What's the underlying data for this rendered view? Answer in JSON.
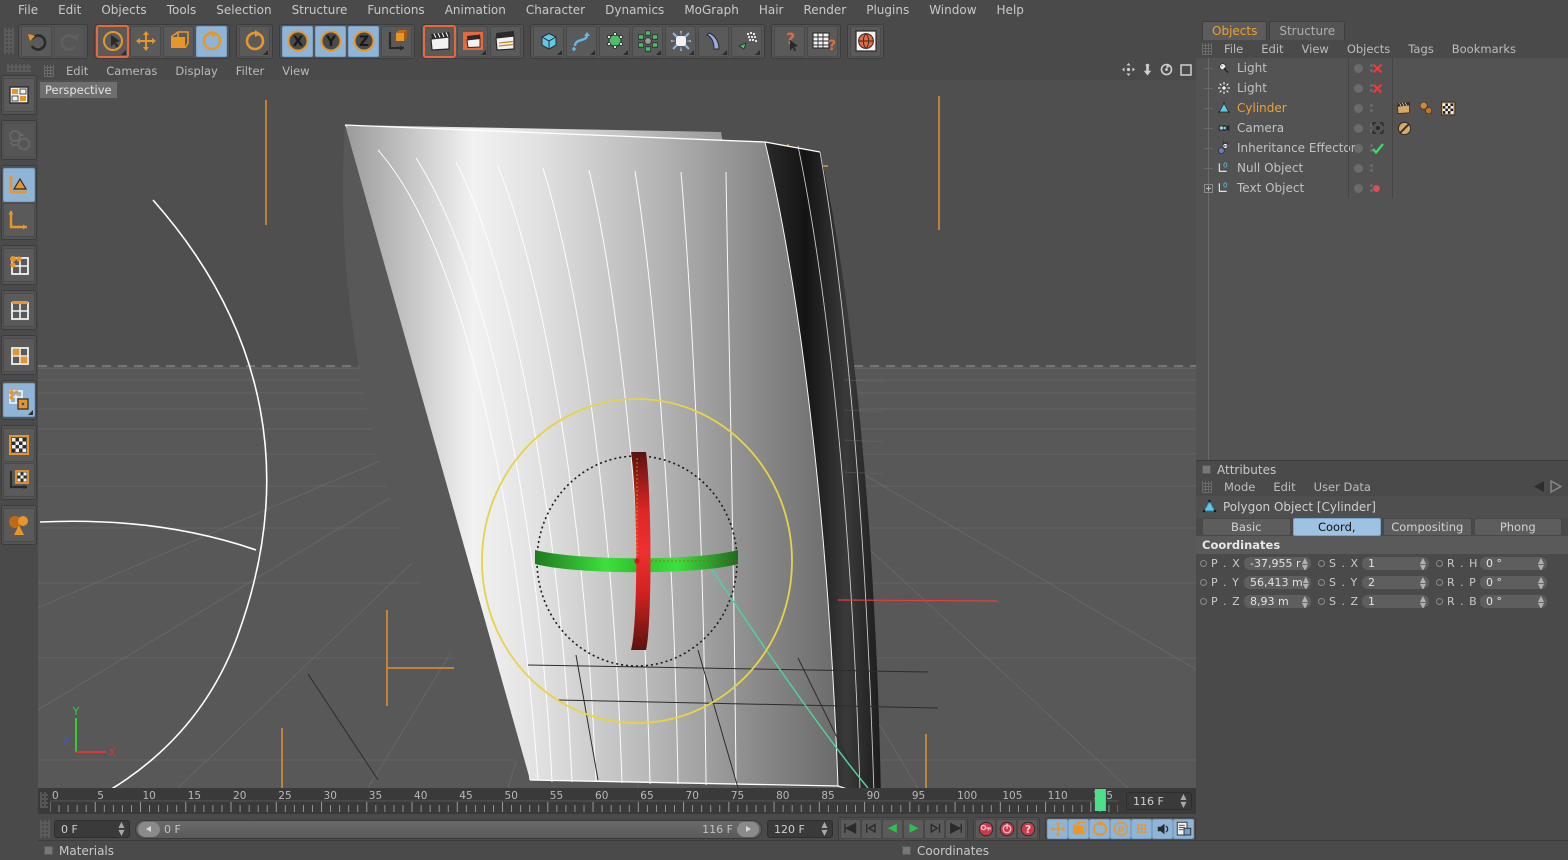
{
  "menubar": [
    "File",
    "Edit",
    "Objects",
    "Tools",
    "Selection",
    "Structure",
    "Functions",
    "Animation",
    "Character",
    "Dynamics",
    "MoGraph",
    "Hair",
    "Render",
    "Plugins",
    "Window",
    "Help"
  ],
  "toolbar": {
    "groups": [
      {
        "items": [
          {
            "name": "undo-button",
            "icon": "undo",
            "state": "normal"
          },
          {
            "name": "redo-button",
            "icon": "redo",
            "state": "disabled"
          }
        ]
      },
      {
        "items": [
          {
            "name": "live-selection-tool",
            "icon": "select-cursor",
            "state": "active-outline",
            "corner": true
          },
          {
            "name": "move-tool",
            "icon": "move-arrows",
            "state": "normal"
          },
          {
            "name": "scale-tool",
            "icon": "scale-box",
            "state": "normal"
          },
          {
            "name": "rotate-tool",
            "icon": "rotate-arc",
            "state": "on"
          }
        ]
      },
      {
        "items": [
          {
            "name": "rotate-tool-2",
            "icon": "rotate-arc",
            "state": "normal",
            "corner": true
          }
        ]
      },
      {
        "items": [
          {
            "name": "axis-x-toggle",
            "icon": "axis-x",
            "state": "on"
          },
          {
            "name": "axis-y-toggle",
            "icon": "axis-y",
            "state": "on"
          },
          {
            "name": "axis-z-toggle",
            "icon": "axis-z",
            "state": "on"
          },
          {
            "name": "world-object-axis-toggle",
            "icon": "world-axis-cube",
            "state": "normal"
          }
        ]
      },
      {
        "items": [
          {
            "name": "render-view-button",
            "icon": "clapper-view",
            "state": "sel"
          },
          {
            "name": "render-region-button",
            "icon": "clapper-region",
            "state": "normal",
            "corner": true
          },
          {
            "name": "render-settings-button",
            "icon": "clapper-settings",
            "state": "normal"
          }
        ]
      },
      {
        "items": [
          {
            "name": "primitive-cube-button",
            "icon": "cube-blue",
            "state": "normal",
            "corner": true
          },
          {
            "name": "spline-button",
            "icon": "spline-curve",
            "state": "normal",
            "corner": true
          },
          {
            "name": "nurbs-button",
            "icon": "nurbs-green",
            "state": "normal",
            "corner": true
          },
          {
            "name": "array-button",
            "icon": "array-green",
            "state": "normal",
            "corner": true
          },
          {
            "name": "deformer-button",
            "icon": "deformer-explode",
            "state": "normal",
            "corner": true
          },
          {
            "name": "bend-button",
            "icon": "bend-blue",
            "state": "normal",
            "corner": true
          },
          {
            "name": "scene-particles-button",
            "icon": "particles",
            "state": "normal",
            "corner": true
          }
        ]
      },
      {
        "items": [
          {
            "name": "help-cursor-button",
            "icon": "question-cursor",
            "state": "normal"
          },
          {
            "name": "content-browser-button",
            "icon": "table-question",
            "state": "normal"
          }
        ]
      },
      {
        "items": [
          {
            "name": "web-button",
            "icon": "globe",
            "state": "normal"
          }
        ]
      }
    ]
  },
  "left_toolbar": [
    {
      "name": "model-mode-button",
      "icon": "model-grid",
      "state": "normal"
    },
    {
      "name": "texture-axis-button",
      "icon": "texture-globe",
      "state": "disabled"
    },
    {
      "name": "object-axis-button",
      "icon": "axis-triangle",
      "state": "on"
    },
    {
      "name": "world-axis-button",
      "icon": "axis-plain",
      "state": "normal"
    },
    {
      "name": "points-mode-button",
      "icon": "points-grid",
      "state": "normal"
    },
    {
      "name": "edges-mode-button",
      "icon": "edges-grid",
      "state": "normal"
    },
    {
      "name": "polygons-mode-button",
      "icon": "polys-grid",
      "state": "normal"
    },
    {
      "name": "uv-points-button",
      "icon": "uv-points",
      "state": "on"
    },
    {
      "name": "texture-mode-button",
      "icon": "checker-box",
      "state": "normal"
    },
    {
      "name": "texture-axis-mode-button",
      "icon": "checker-axis",
      "state": "normal"
    },
    {
      "name": "viewport-solo-button",
      "icon": "spheres-cone",
      "state": "normal"
    }
  ],
  "viewport": {
    "menu": [
      "Edit",
      "Cameras",
      "Display",
      "Filter",
      "View"
    ],
    "label": "Perspective",
    "nav_icons": [
      "pan-icon",
      "zoom-icon",
      "rotate-icon",
      "maximize-icon"
    ],
    "axis_gizmo": {
      "x": "X",
      "y": "Y",
      "z": "Z"
    }
  },
  "timeline": {
    "ticks": [
      0,
      5,
      10,
      15,
      20,
      25,
      30,
      35,
      40,
      45,
      50,
      55,
      60,
      65,
      70,
      75,
      80,
      85,
      90,
      95,
      100,
      105,
      110,
      115
    ],
    "min": 0,
    "max": 118,
    "playhead": 116,
    "end_frame_field": "116 F"
  },
  "transport": {
    "current_frame_field": "0 F",
    "slider_left_label": "0 F",
    "slider_right_label": "116 F",
    "document_end_field": "120 F",
    "buttons": [
      {
        "name": "go-to-start-button",
        "icon": "skip-start"
      },
      {
        "name": "step-back-button",
        "icon": "step-back"
      },
      {
        "name": "play-backwards-button",
        "icon": "play-back"
      },
      {
        "name": "play-forwards-button",
        "icon": "play-forward"
      },
      {
        "name": "step-forward-button",
        "icon": "step-forward"
      },
      {
        "name": "go-to-end-button",
        "icon": "skip-end"
      }
    ],
    "key_buttons": [
      {
        "name": "record-keyframe-button",
        "icon": "key-red"
      },
      {
        "name": "autokeying-button",
        "icon": "autokey-red"
      },
      {
        "name": "keyframe-selection-button",
        "icon": "key-question"
      }
    ],
    "param_buttons": [
      {
        "name": "key-position-button",
        "icon": "move-arrows",
        "state": "on"
      },
      {
        "name": "key-scale-button",
        "icon": "scale-box",
        "state": "on"
      },
      {
        "name": "key-rotation-button",
        "icon": "rotate-arc",
        "state": "on"
      },
      {
        "name": "key-pla-button",
        "icon": "pla-circle",
        "state": "on"
      },
      {
        "name": "key-points-button",
        "icon": "points-dots",
        "state": "on"
      },
      {
        "name": "key-sound-button",
        "icon": "sound-icon",
        "state": "on"
      },
      {
        "name": "timeline-button",
        "icon": "doc-window",
        "state": "on"
      }
    ]
  },
  "status": {
    "left_panel": "Materials",
    "right_panel": "Coordinates"
  },
  "objects_panel": {
    "tabs": [
      {
        "label": "Objects",
        "active": true
      },
      {
        "label": "Structure",
        "active": false
      }
    ],
    "menu": [
      "File",
      "Edit",
      "View",
      "Objects",
      "Tags",
      "Bookmarks"
    ],
    "rows": [
      {
        "name": "Light",
        "icon": "light-icon",
        "selected": false,
        "mark": "x-red",
        "tags": [],
        "expander": false
      },
      {
        "name": "Light",
        "icon": "light-area-icon",
        "selected": false,
        "mark": "x-red",
        "tags": [],
        "expander": false
      },
      {
        "name": "Cylinder",
        "icon": "polygon-object-icon",
        "selected": true,
        "mark": "none",
        "tags": [
          "clapper-tag",
          "material-tag",
          "checker-tag"
        ],
        "expander": false
      },
      {
        "name": "Camera",
        "icon": "camera-icon",
        "selected": false,
        "mark": "target",
        "tags": [
          "protection-tag"
        ],
        "expander": false
      },
      {
        "name": "Inheritance Effector",
        "icon": "effector-icon",
        "selected": false,
        "mark": "check-green",
        "tags": [],
        "expander": false
      },
      {
        "name": "Null Object",
        "icon": "null-icon",
        "selected": false,
        "mark": "none",
        "tags": [],
        "expander": false
      },
      {
        "name": "Text Object",
        "icon": "null-icon",
        "selected": false,
        "mark": "dot-red",
        "tags": [],
        "expander": true
      }
    ]
  },
  "attributes_panel": {
    "title": "Attributes",
    "menu": [
      "Mode",
      "Edit",
      "User Data"
    ],
    "object_header": "Polygon Object [Cylinder]",
    "tabs": [
      {
        "label": "Basic",
        "active": false
      },
      {
        "label": "Coord,",
        "active": true
      },
      {
        "label": "Compositing",
        "active": false
      },
      {
        "label": "Phong",
        "active": false
      }
    ],
    "section_title": "Coordinates",
    "coords": [
      {
        "label": "P . X",
        "value": "-37,955 r"
      },
      {
        "label": "S . X",
        "value": "1"
      },
      {
        "label": "R . H",
        "value": "0 °"
      },
      {
        "label": "P . Y",
        "value": "56,413 m"
      },
      {
        "label": "S . Y",
        "value": "2"
      },
      {
        "label": "R . P",
        "value": "0 °"
      },
      {
        "label": "P . Z",
        "value": "8,93 m"
      },
      {
        "label": "S . Z",
        "value": "1"
      },
      {
        "label": "R . B",
        "value": "0 °"
      }
    ]
  },
  "colors": {
    "accent_orange": "#f0a030",
    "active_blue": "#8fb4d6",
    "select_outline": "#e8683c",
    "panel_bg": "#4a4a4a",
    "viewport_bg": "#585858"
  }
}
